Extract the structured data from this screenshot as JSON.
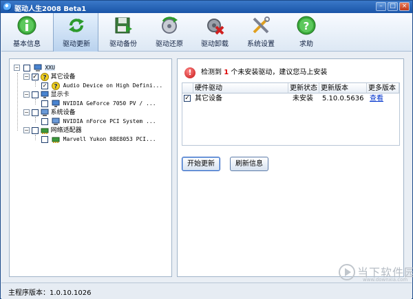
{
  "window": {
    "title": "驱动人生2008 Beta1",
    "minimize_glyph": "–",
    "maximize_glyph": "□",
    "close_glyph": "×"
  },
  "toolbar": {
    "items": [
      {
        "label": "基本信息",
        "icon": "info-icon",
        "active": false
      },
      {
        "label": "驱动更新",
        "icon": "refresh-icon",
        "active": true
      },
      {
        "label": "驱动备份",
        "icon": "backup-icon",
        "active": false
      },
      {
        "label": "驱动还原",
        "icon": "restore-icon",
        "active": false
      },
      {
        "label": "驱动卸载",
        "icon": "uninstall-icon",
        "active": false
      },
      {
        "label": "系统设置",
        "icon": "settings-tools-icon",
        "active": false
      },
      {
        "label": "求助",
        "icon": "help-icon",
        "active": false
      }
    ]
  },
  "tree": {
    "root": {
      "label": "XXU",
      "checked": false
    },
    "categories": [
      {
        "label": "其它设备",
        "checked": true,
        "icon": "unknown-device-icon",
        "child": {
          "label": "Audio Device on High Defini...",
          "checked": true
        }
      },
      {
        "label": "显示卡",
        "checked": false,
        "icon": "display-icon",
        "child": {
          "label": "NVIDIA GeForce 7050 PV / ...",
          "checked": false
        }
      },
      {
        "label": "系统设备",
        "checked": false,
        "icon": "system-device-icon",
        "child": {
          "label": "NVIDIA nForce PCI System ...",
          "checked": false
        }
      },
      {
        "label": "网络适配器",
        "checked": false,
        "icon": "network-adapter-icon",
        "child": {
          "label": "Marvell Yukon 88E8053 PCI...",
          "checked": false
        }
      }
    ]
  },
  "alert": {
    "prefix": "检测到 ",
    "count": "1",
    "suffix": " 个未安装驱动，建议您马上安装"
  },
  "table": {
    "headers": [
      "硬件驱动",
      "更新状态",
      "更新版本",
      "更多版本"
    ],
    "rows": [
      {
        "checked": true,
        "device": "其它设备",
        "status": "未安装",
        "version": "5.10.0.5636",
        "more": "查看"
      }
    ]
  },
  "buttons": {
    "start_update": "开始更新",
    "refresh_info": "刷新信息"
  },
  "status_bar": {
    "version_label": "主程序版本：1.0.10.1026"
  },
  "watermark": {
    "text": "当下软件园",
    "url": "www.downxia.com"
  },
  "colors": {
    "accent": "#1a55a8",
    "alert_red": "#dd0000",
    "link_blue": "#0033cc"
  }
}
